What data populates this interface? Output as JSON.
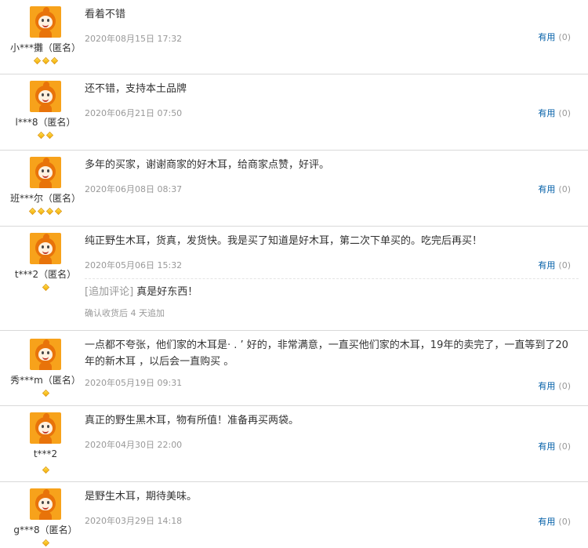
{
  "reviews": [
    {
      "user": "小***攤（匿名）",
      "level": 3,
      "text": "看着不错",
      "date": "2020年08月15日 17:32",
      "useful_label": "有用",
      "useful_count": "(0)"
    },
    {
      "user": "l***8（匿名）",
      "level": 2,
      "text": "还不错，支持本土品牌",
      "date": "2020年06月21日 07:50",
      "useful_label": "有用",
      "useful_count": "(0)"
    },
    {
      "user": "班***尔（匿名）",
      "level": 4,
      "text": "多年的买家，谢谢商家的好木耳，给商家点赞，好评。",
      "date": "2020年06月08日 08:37",
      "useful_label": "有用",
      "useful_count": "(0)"
    },
    {
      "user": "t***2（匿名）",
      "level": 1,
      "text": "纯正野生木耳，货真，发货快。我是买了知道是好木耳，第二次下单买的。吃完后再买！",
      "date": "2020年05月06日 15:32",
      "useful_label": "有用",
      "useful_count": "(0)",
      "append_tag": "[追加评论]",
      "append_text": " 真是好东西！",
      "append_note": "确认收货后 4 天追加"
    },
    {
      "user": "秀***m（匿名）",
      "level": 1,
      "text": "一点都不夸张，他们家的木耳是· . ’ 好的，非常满意，一直买他们家的木耳，19年的卖完了，一直等到了20 年的新木耳 ，以后会一直购买 。",
      "date": "2020年05月19日 09:31",
      "useful_label": "有用",
      "useful_count": "(0)"
    },
    {
      "user": "t***2",
      "level": 1,
      "text": "真正的野生黑木耳，物有所值！准备再买两袋。",
      "date": "2020年04月30日 22:00",
      "useful_label": "有用",
      "useful_count": "(0)"
    },
    {
      "user": "g***8（匿名）",
      "level": 1,
      "text": "是野生木耳，期待美味。",
      "date": "2020年03月29日 14:18",
      "useful_label": "有用",
      "useful_count": "(0)"
    }
  ]
}
